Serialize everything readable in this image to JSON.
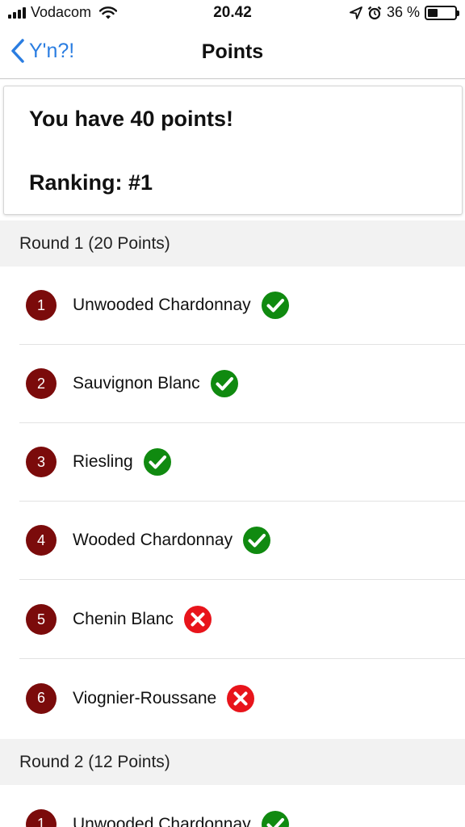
{
  "status_bar": {
    "carrier": "Vodacom",
    "time": "20.42",
    "battery_text": "36 %",
    "battery_level": 0.36,
    "icons": [
      "signal-icon",
      "wifi-icon",
      "location-icon",
      "alarm-icon",
      "battery-icon"
    ]
  },
  "nav": {
    "back_label": "Y'n?!",
    "title": "Points"
  },
  "summary": {
    "points_text": "You have 40 points!",
    "ranking_text": "Ranking: #1"
  },
  "colors": {
    "accent": "#2a7de1",
    "badge": "#7b0b0b",
    "correct": "#108a10",
    "wrong": "#e8141b"
  },
  "rounds": [
    {
      "title": "Round 1 (20 Points)",
      "items": [
        {
          "number": "1",
          "name": "Unwooded Chardonnay",
          "status": "correct"
        },
        {
          "number": "2",
          "name": "Sauvignon Blanc",
          "status": "correct"
        },
        {
          "number": "3",
          "name": "Riesling",
          "status": "correct"
        },
        {
          "number": "4",
          "name": "Wooded Chardonnay",
          "status": "correct"
        },
        {
          "number": "5",
          "name": "Chenin Blanc",
          "status": "wrong"
        },
        {
          "number": "6",
          "name": "Viognier-Roussane",
          "status": "wrong"
        }
      ]
    },
    {
      "title": "Round 2 (12 Points)",
      "items": [
        {
          "number": "1",
          "name": "Unwooded Chardonnay",
          "status": "correct"
        }
      ]
    }
  ]
}
